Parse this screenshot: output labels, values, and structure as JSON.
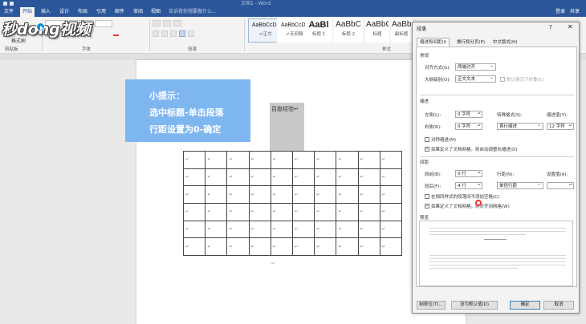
{
  "window": {
    "title": "文档1 - Word",
    "account": {
      "signin": "登录",
      "share": "共享"
    }
  },
  "tabs": [
    {
      "label": "文件",
      "active": false
    },
    {
      "label": "开始",
      "active": true
    },
    {
      "label": "插入",
      "active": false
    },
    {
      "label": "设计",
      "active": false
    },
    {
      "label": "布局",
      "active": false
    },
    {
      "label": "引用",
      "active": false
    },
    {
      "label": "邮件",
      "active": false
    },
    {
      "label": "审阅",
      "active": false
    },
    {
      "label": "视图",
      "active": false
    }
  ],
  "tellme": "告诉我你想要做什么...",
  "ribbon": {
    "clipboard": {
      "format_painter": "格式刷",
      "group": "剪贴板"
    },
    "font": {
      "group": "字体"
    },
    "paragraph": {
      "group": "段落"
    },
    "styles": {
      "group": "样式",
      "items": [
        {
          "sample": "AaBbCcDc",
          "name": "↵正文",
          "selected": true
        },
        {
          "sample": "AaBbCcDc",
          "name": "↵无间隔",
          "selected": false
        },
        {
          "sample": "AaBl",
          "name": "标题 1",
          "selected": false
        },
        {
          "sample": "AaBbC",
          "name": "标题 2",
          "selected": false
        },
        {
          "sample": "AaBbC",
          "name": "标题",
          "selected": false
        },
        {
          "sample": "AaBbC",
          "name": "副标题",
          "selected": false
        }
      ]
    }
  },
  "logo_text": "秒dong视频",
  "tip": {
    "lines": [
      "小提示：",
      "选中标题-单击段落",
      "行距设置为0-确定"
    ]
  },
  "document": {
    "highlight_text": "百度经验↵",
    "cell_mark": "↵",
    "rows": 6,
    "cols": 10
  },
  "dialog": {
    "title": "段落",
    "help": "?",
    "close": "✕",
    "tabs": [
      {
        "label": "缩进和间距(I)",
        "active": true
      },
      {
        "label": "换行和分页(P)",
        "active": false
      },
      {
        "label": "中文版式(H)",
        "active": false
      }
    ],
    "general": {
      "heading": "常规",
      "alignment_label": "对齐方式(G):",
      "alignment_value": "两端对齐",
      "outline_label": "大纲级别(O):",
      "outline_value": "正文文本",
      "collapse_label": "默认情况下折叠(E)"
    },
    "indent": {
      "heading": "缩进",
      "left_label": "左侧(L):",
      "left_value": "0 字符",
      "right_label": "右侧(R):",
      "right_value": "0 字符",
      "special_label": "特殊格式(S):",
      "special_value": "首行缩进",
      "by_label": "缩进值(Y):",
      "by_value": "12 字符",
      "mirror_label": "对称缩进(M)",
      "auto_label": "如果定义了文档网格，则自动调整右缩进(D)"
    },
    "spacing": {
      "heading": "间距",
      "before_label": "段前(B):",
      "before_value": "0 行",
      "after_label": "段后(F):",
      "after_value": "4 行",
      "line_label": "行距(N):",
      "line_value": "单倍行距",
      "at_label": "设置值(A):",
      "at_value": "",
      "nospace_label": "在相同样式的段落间不添加空格(C)",
      "grid_label": "如果定义了文档网格，则对齐到网格(W)"
    },
    "preview": {
      "heading": "预览"
    },
    "buttons": {
      "tabs": "制表位(T)...",
      "default": "设为默认值(D)",
      "ok": "确定",
      "cancel": "取消"
    }
  }
}
